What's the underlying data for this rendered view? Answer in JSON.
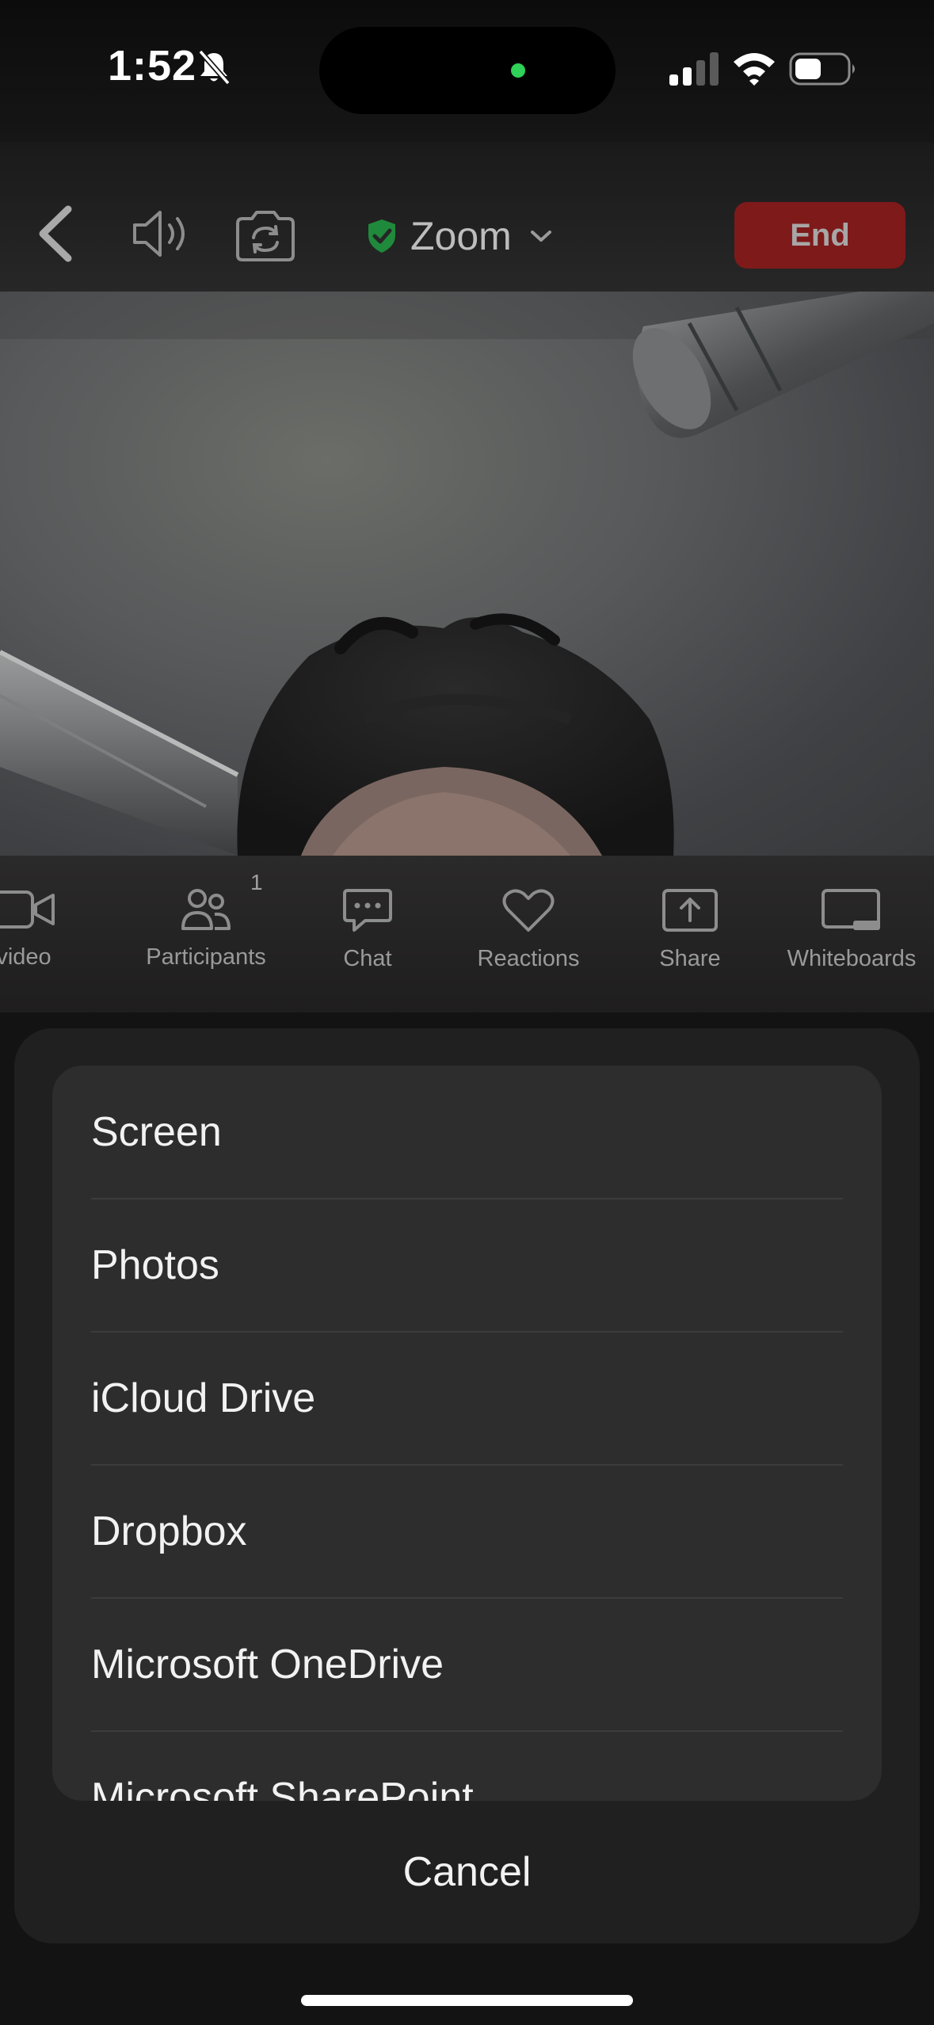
{
  "status": {
    "time": "1:52"
  },
  "meeting": {
    "title": "Zoom",
    "end_label": "End"
  },
  "toolbar": {
    "items": [
      {
        "label": "video",
        "icon": "video-camera-icon"
      },
      {
        "label": "Participants",
        "icon": "participants-icon",
        "badge": "1"
      },
      {
        "label": "Chat",
        "icon": "chat-icon"
      },
      {
        "label": "Reactions",
        "icon": "heart-icon"
      },
      {
        "label": "Share",
        "icon": "share-upload-icon"
      },
      {
        "label": "Whiteboards",
        "icon": "whiteboard-icon"
      }
    ]
  },
  "share_sheet": {
    "options": [
      "Screen",
      "Photos",
      "iCloud Drive",
      "Dropbox",
      "Microsoft OneDrive",
      "Microsoft SharePoint"
    ],
    "cancel_label": "Cancel"
  },
  "colors": {
    "end_button": "#7e1a1a",
    "shield_green": "#1f8a3c",
    "camera_dot": "#2fd158",
    "sheet_bg": "#202020"
  }
}
